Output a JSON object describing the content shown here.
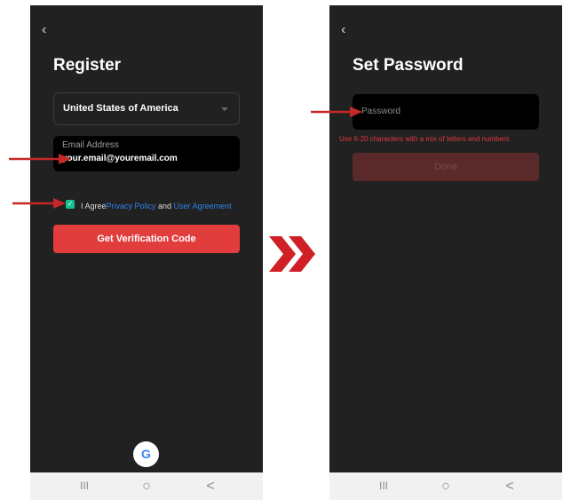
{
  "register_screen": {
    "back_glyph": "‹",
    "title": "Register",
    "country": "United States of America",
    "email_label": "Email Address",
    "email_value": "your.email@youremail.com",
    "agree_prefix": "I Agree",
    "privacy_link": "Privacy Policy",
    "and_text": " and ",
    "user_agreement_link": "User Agreement",
    "checkbox_checked": true,
    "verify_button": "Get Verification Code",
    "google_glyph": "G"
  },
  "password_screen": {
    "back_glyph": "‹",
    "title": "Set Password",
    "password_placeholder": "Password",
    "hint": "Use 6-20 characters with a mix of letters and numbers",
    "done_button": "Done"
  },
  "android_nav": {
    "recents_glyph": "III",
    "home_glyph": "○",
    "back_glyph": "<"
  },
  "colors": {
    "screen_bg": "#212121",
    "accent_red": "#e23d3d",
    "link_blue": "#2f80ed",
    "check_green": "#14c08f",
    "annotation_red": "#c62828"
  },
  "icons": [
    "back-chevron-icon",
    "dropdown-caret-icon",
    "checkbox-check-icon",
    "google-logo-icon",
    "annotation-arrow-icon",
    "next-step-chevrons-icon"
  ]
}
